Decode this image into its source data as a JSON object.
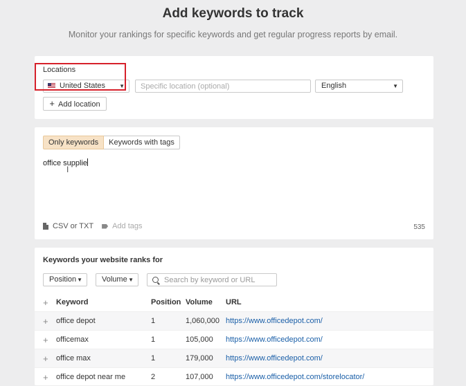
{
  "header": {
    "title": "Add keywords to track",
    "subtitle": "Monitor your rankings for specific keywords and get regular progress reports by email."
  },
  "locations": {
    "label": "Locations",
    "country": "United States",
    "specific_placeholder": "Specific location (optional)",
    "language": "English",
    "add_location_label": "Add location"
  },
  "keywords_input": {
    "tabs": [
      {
        "label": "Only keywords",
        "active": true
      },
      {
        "label": "Keywords with tags",
        "active": false
      }
    ],
    "text": "office supplie",
    "csv_label": "CSV or TXT",
    "add_tags_label": "Add tags",
    "char_count": "535"
  },
  "ranks": {
    "title": "Keywords your website ranks for",
    "position_filter": "Position",
    "volume_filter": "Volume",
    "search_placeholder": "Search by keyword or URL",
    "columns": {
      "keyword": "Keyword",
      "position": "Position",
      "volume": "Volume",
      "url": "URL"
    },
    "rows": [
      {
        "keyword": "office depot",
        "position": "1",
        "volume": "1,060,000",
        "url": "https://www.officedepot.com/"
      },
      {
        "keyword": "officemax",
        "position": "1",
        "volume": "105,000",
        "url": "https://www.officedepot.com/"
      },
      {
        "keyword": "office max",
        "position": "1",
        "volume": "179,000",
        "url": "https://www.officedepot.com/"
      },
      {
        "keyword": "office depot near me",
        "position": "2",
        "volume": "107,000",
        "url": "https://www.officedepot.com/storelocator/"
      }
    ]
  },
  "colors": {
    "accent_highlight": "#d6202a",
    "active_tab": "#f7e2c6",
    "link": "#1a5fa8"
  }
}
